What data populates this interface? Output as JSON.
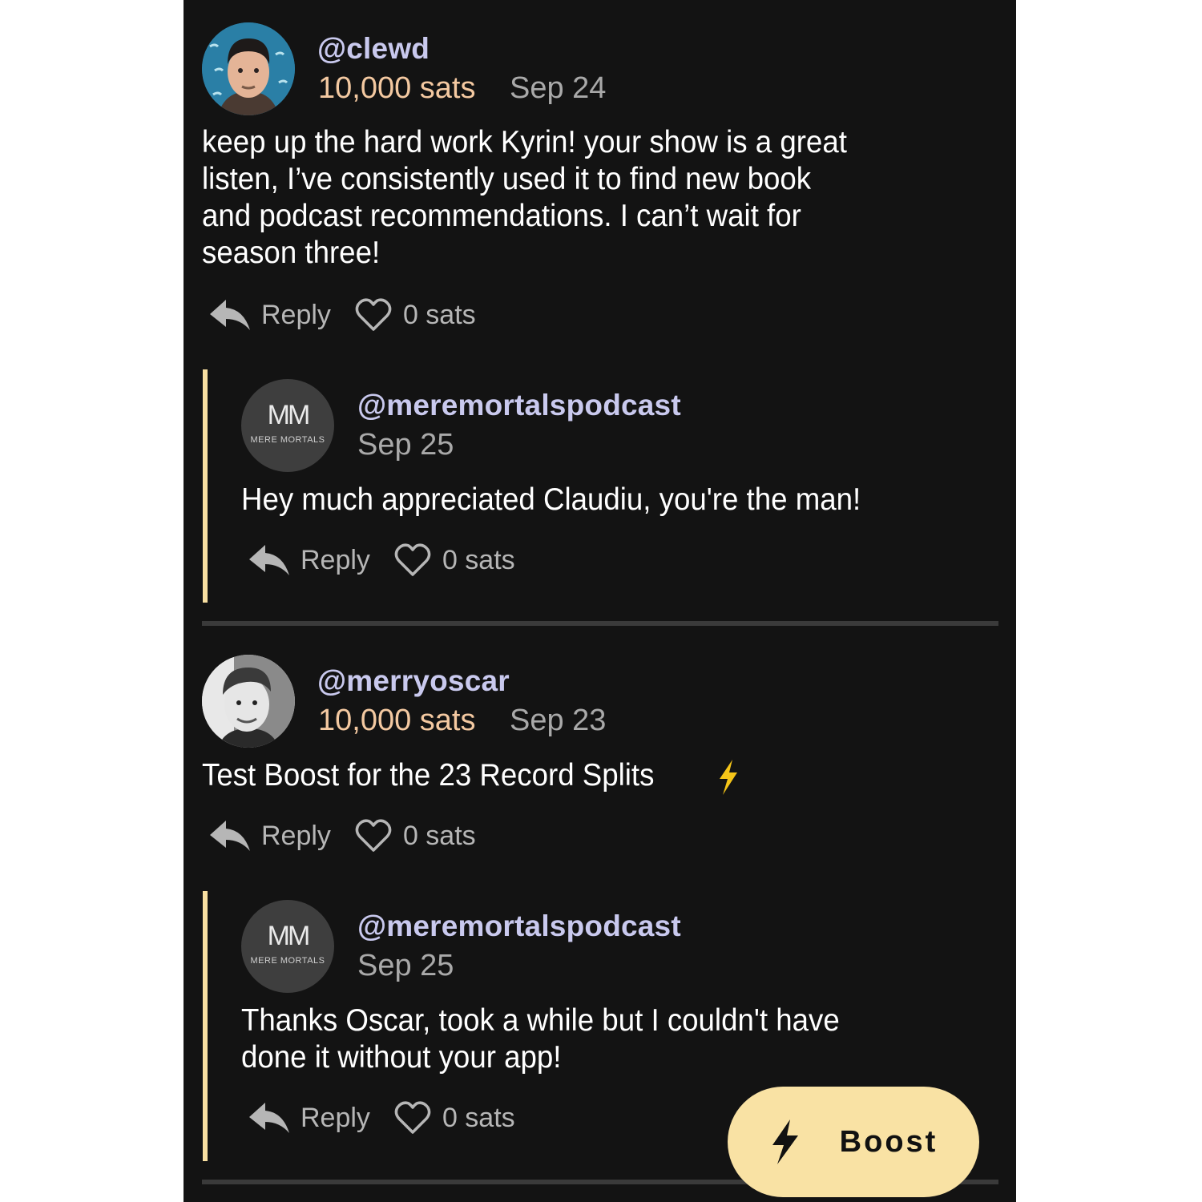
{
  "theme": {
    "background": "#131313",
    "username_color": "#c9c9ee",
    "amount_color": "#f4c9a1",
    "thread_bar_color": "#f8dfa1",
    "boost_button_color": "#f9e2a4"
  },
  "comments": [
    {
      "username": "@clewd",
      "amount": "10,000 sats",
      "date": "Sep 24",
      "text": "keep up the hard work Kyrin! your show is a great\nlisten, I’ve consistently used it to find new book\nand podcast recommendations. I can’t wait for\nseason three!",
      "reply_label": "Reply",
      "likes": "0 sats",
      "avatar_icon": "user-avatar",
      "replies": [
        {
          "username": "@meremortalspodcast",
          "date": "Sep 25",
          "avatar_initials": "MM",
          "avatar_subtitle": "MERE MORTALS",
          "text": "Hey much appreciated Claudiu, you're the man!",
          "reply_label": "Reply",
          "likes": "0 sats"
        }
      ]
    },
    {
      "username": "@merryoscar",
      "amount": "10,000 sats",
      "date": "Sep 23",
      "text": "Test Boost for the 23 Record Splits",
      "emoji": "⚡",
      "reply_label": "Reply",
      "likes": "0 sats",
      "avatar_icon": "user-avatar",
      "replies": [
        {
          "username": "@meremortalspodcast",
          "date": "Sep 25",
          "avatar_initials": "MM",
          "avatar_subtitle": "MERE MORTALS",
          "text": "Thanks Oscar, took a while but I couldn't have\ndone it without your app!",
          "reply_label": "Reply",
          "likes": "0 sats"
        }
      ]
    }
  ],
  "boost_button": {
    "label": "Boost",
    "icon": "lightning-bolt-icon"
  }
}
